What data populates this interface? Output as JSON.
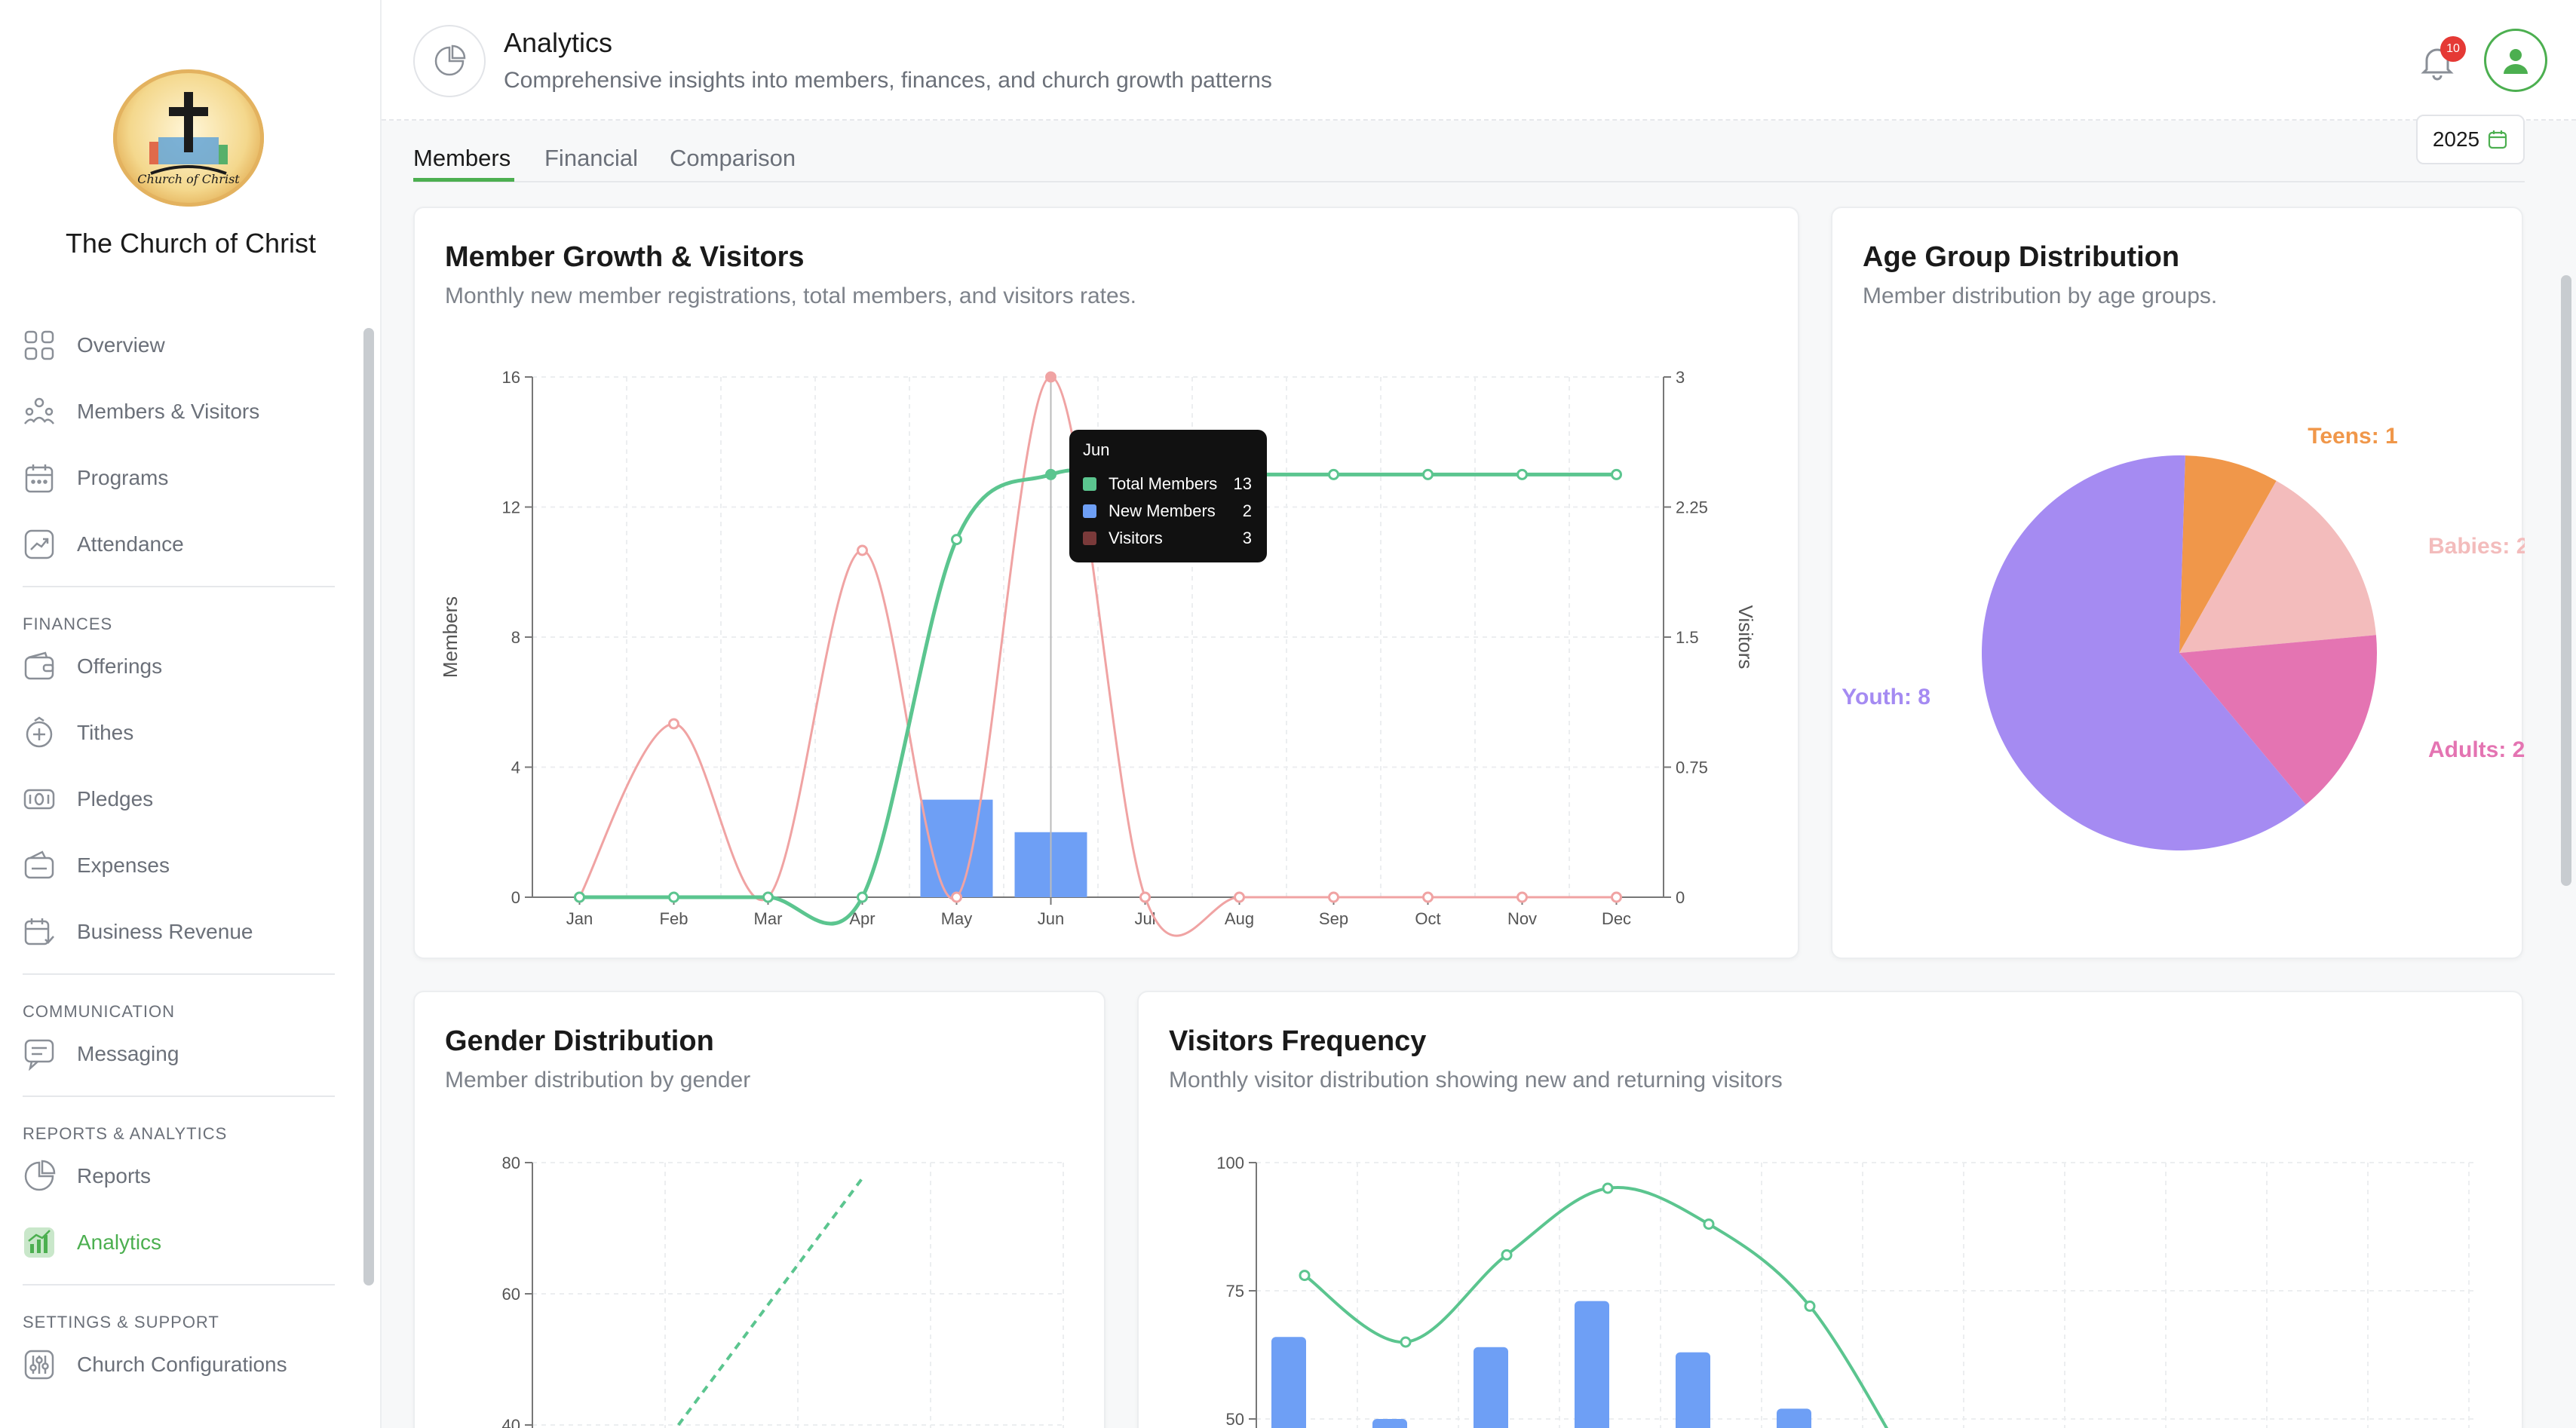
{
  "sidebar": {
    "church_name": "The Church of Christ",
    "logo_text": "Church of Christ",
    "items": [
      {
        "label": "Overview",
        "icon": "grid-icon"
      },
      {
        "label": "Members & Visitors",
        "icon": "users-icon"
      },
      {
        "label": "Programs",
        "icon": "calendar-icon"
      },
      {
        "label": "Attendance",
        "icon": "trend-icon"
      }
    ],
    "sections": [
      {
        "title": "FINANCES",
        "items": [
          {
            "label": "Offerings",
            "icon": "wallet-icon"
          },
          {
            "label": "Tithes",
            "icon": "coin-plus-icon"
          },
          {
            "label": "Pledges",
            "icon": "banknote-icon"
          },
          {
            "label": "Expenses",
            "icon": "wallet-out-icon"
          },
          {
            "label": "Business Revenue",
            "icon": "calendar-check-icon"
          }
        ]
      },
      {
        "title": "COMMUNICATION",
        "items": [
          {
            "label": "Messaging",
            "icon": "message-icon"
          }
        ]
      },
      {
        "title": "REPORTS & ANALYTICS",
        "items": [
          {
            "label": "Reports",
            "icon": "pie-icon"
          },
          {
            "label": "Analytics",
            "icon": "analytics-icon",
            "active": true
          }
        ]
      },
      {
        "title": "SETTINGS & SUPPORT",
        "items": [
          {
            "label": "Church Configurations",
            "icon": "sliders-icon"
          }
        ]
      }
    ]
  },
  "header": {
    "title": "Analytics",
    "subtitle": "Comprehensive insights into members, finances, and church growth patterns",
    "notification_count": "10"
  },
  "tabs": [
    "Members",
    "Financial",
    "Comparison"
  ],
  "active_tab": "Members",
  "year": "2025",
  "colors": {
    "accent": "#4caf50",
    "total_members": "#5bc58f",
    "new_members": "#6e9ff5",
    "visitors": "#f0a3a3",
    "teens": "#f0974a",
    "babies": "#f3bcbc",
    "adults": "#e474b2",
    "youth": "#a58bf2"
  },
  "cards": {
    "growth": {
      "title": "Member Growth & Visitors",
      "subtitle": "Monthly new member registrations, total members, and visitors rates."
    },
    "age": {
      "title": "Age Group Distribution",
      "subtitle": "Member distribution by age groups."
    },
    "gender": {
      "title": "Gender Distribution",
      "subtitle": "Member distribution by gender"
    },
    "visitors": {
      "title": "Visitors Frequency",
      "subtitle": "Monthly visitor distribution showing new and returning visitors"
    }
  },
  "tooltip": {
    "month": "Jun",
    "rows": [
      {
        "name": "Total Members",
        "value": "13",
        "color": "#5bc58f"
      },
      {
        "name": "New Members",
        "value": "2",
        "color": "#6e9ff5"
      },
      {
        "name": "Visitors",
        "value": "3",
        "color": "#7a3a3a"
      }
    ]
  },
  "chart_data": [
    {
      "type": "bar",
      "title": "Member Growth & Visitors",
      "ylabel": "Members",
      "y2label": "Visitors",
      "categories": [
        "Jan",
        "Feb",
        "Mar",
        "Apr",
        "May",
        "Jun",
        "Jul",
        "Aug",
        "Sep",
        "Oct",
        "Nov",
        "Dec"
      ],
      "ylim": [
        0,
        16
      ],
      "yticks": [
        "0",
        "4",
        "8",
        "12",
        "16"
      ],
      "y2lim": [
        0,
        3
      ],
      "y2ticks": [
        "0",
        "0.75",
        "1.5",
        "2.25",
        "3"
      ],
      "series": [
        {
          "name": "Total Members",
          "kind": "line",
          "axis": "left",
          "values": [
            0,
            0,
            0,
            0,
            11,
            13,
            13,
            13,
            13,
            13,
            13,
            13
          ]
        },
        {
          "name": "New Members",
          "kind": "bar",
          "axis": "left",
          "values": [
            0,
            0,
            0,
            0,
            3,
            2,
            0,
            0,
            0,
            0,
            0,
            0
          ]
        },
        {
          "name": "Visitors",
          "kind": "line",
          "axis": "right",
          "values": [
            0,
            1,
            0,
            2,
            0,
            3,
            0,
            0,
            0,
            0,
            0,
            0
          ]
        }
      ],
      "grid": true
    },
    {
      "type": "pie",
      "title": "Age Group Distribution",
      "slices": [
        {
          "label": "Teens: 1",
          "name": "Teens",
          "value": 1
        },
        {
          "label": "Babies: 2",
          "name": "Babies",
          "value": 2
        },
        {
          "label": "Adults: 2",
          "name": "Adults",
          "value": 2
        },
        {
          "label": "Youth: 8",
          "name": "Youth",
          "value": 8
        }
      ]
    },
    {
      "type": "line",
      "title": "Gender Distribution",
      "yticks": [
        "40",
        "60",
        "80"
      ],
      "visible_ylim": [
        40,
        80
      ],
      "series": [
        {
          "kind": "dashed-line",
          "points": [
            [
              1.6,
              40
            ],
            [
              3,
              78
            ]
          ]
        }
      ],
      "grid": true
    },
    {
      "type": "bar",
      "title": "Visitors Frequency",
      "yticks": [
        "50",
        "75",
        "100"
      ],
      "visible_ylim": [
        50,
        100
      ],
      "bars": [
        66,
        50,
        64,
        73,
        63,
        52
      ],
      "line": [
        78,
        65,
        82,
        95,
        88,
        72,
        40
      ],
      "grid": true
    }
  ]
}
